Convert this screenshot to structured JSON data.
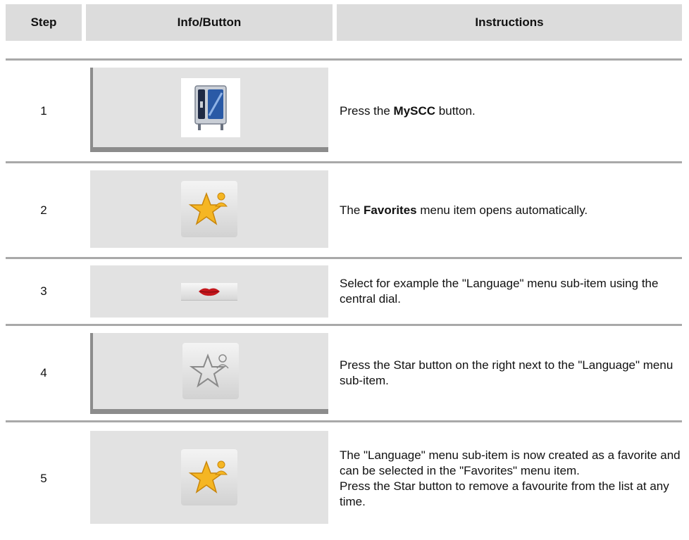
{
  "headers": {
    "step": "Step",
    "info": "Info/Button",
    "instructions": "Instructions"
  },
  "rows": [
    {
      "step": "1",
      "icon": "myscc-oven-icon",
      "instr": [
        {
          "t": "Press the ",
          "b": false
        },
        {
          "t": "MySCC",
          "b": true
        },
        {
          "t": " button.",
          "b": false
        }
      ]
    },
    {
      "step": "2",
      "icon": "favorites-star-icon",
      "instr": [
        {
          "t": "The ",
          "b": false
        },
        {
          "t": "Favorites",
          "b": true
        },
        {
          "t": " menu item opens automatically.",
          "b": false
        }
      ]
    },
    {
      "step": "3",
      "icon": "language-lips-icon",
      "instr": [
        {
          "t": "Select for example the \"Language\" menu sub-item using the central dial.",
          "b": false
        }
      ]
    },
    {
      "step": "4",
      "icon": "star-outline-icon",
      "instr": [
        {
          "t": "Press the Star button on the right next to the \"Language\" menu sub-item.",
          "b": false
        }
      ]
    },
    {
      "step": "5",
      "icon": "favorites-star-icon",
      "instr": [
        {
          "t": "The \"Language\" menu sub-item is now created as a favorite and can be selected in the \"Favorites\" menu item.",
          "b": false
        },
        {
          "br": true
        },
        {
          "t": "Press the Star button to remove a favourite from the list at any time.",
          "b": false
        }
      ]
    }
  ]
}
